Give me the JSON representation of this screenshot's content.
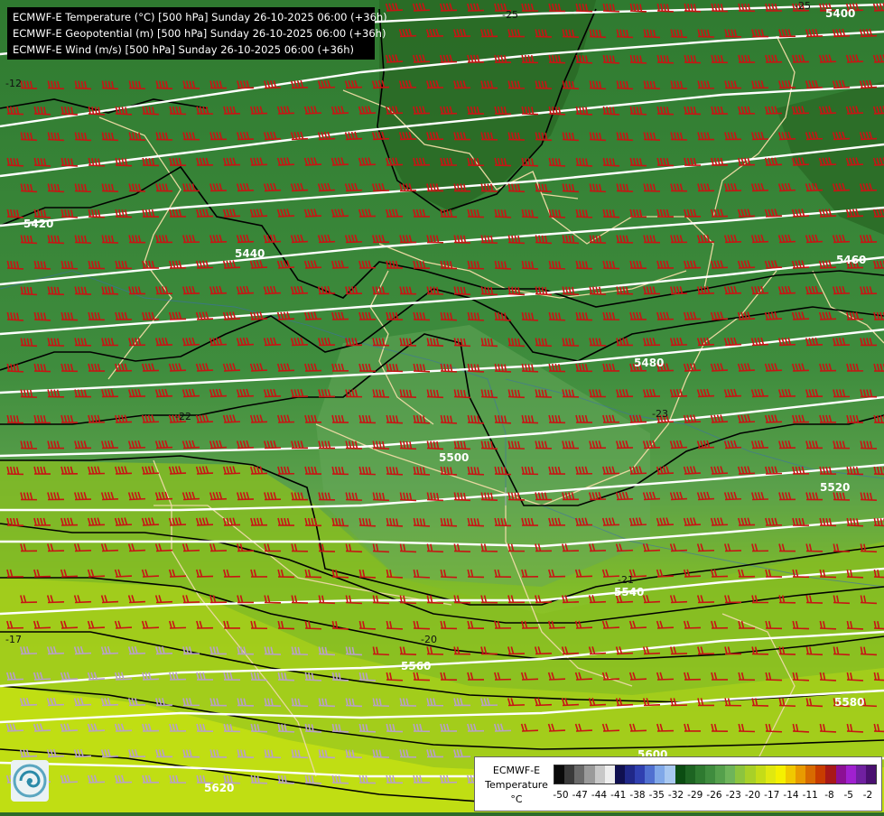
{
  "title_lines": [
    "ECMWF-E Temperature (°C) [500 hPa] Sunday 26-10-2025 06:00 (+36h)",
    "ECMWF-E Geopotential (m) [500 hPa] Sunday 26-10-2025 06:00 (+36h)",
    "ECMWF-E Wind (m/s) [500 hPa] Sunday 26-10-2025 06:00 (+36h)"
  ],
  "geopotential_labels": [
    "5400",
    "5420",
    "5440",
    "5460",
    "5480",
    "5500",
    "5520",
    "5540",
    "5560",
    "5580",
    "5600",
    "5620"
  ],
  "temperature_labels": [
    "-25",
    "-25",
    "-22",
    "-23",
    "-21",
    "-20",
    "-17",
    "-12"
  ],
  "legend": {
    "title_lines": [
      "ECMWF-E",
      "Temperature",
      "°C"
    ],
    "ticks": [
      "-50",
      "-47",
      "-44",
      "-41",
      "-38",
      "-35",
      "-32",
      "-29",
      "-26",
      "-23",
      "-20",
      "-17",
      "-14",
      "-11",
      "-8",
      "-5",
      "-2"
    ],
    "colors": [
      "#0a0a0a",
      "#3a3a3a",
      "#6a6a6a",
      "#9a9a9a",
      "#c8c8c8",
      "#eeeeee",
      "#101050",
      "#202888",
      "#3040b0",
      "#5070d0",
      "#80a8e8",
      "#a8c8f0",
      "#0b4d12",
      "#1d6422",
      "#2e7a30",
      "#3f8c3e",
      "#55a04c",
      "#6eb45a",
      "#8cc43e",
      "#a8d028",
      "#c4dc18",
      "#e0e810",
      "#f5f000",
      "#f0c800",
      "#e89a00",
      "#d86a00",
      "#c83c00",
      "#a81818",
      "#8c1094",
      "#a020d0",
      "#7020a0",
      "#4a1070"
    ]
  },
  "colors": {
    "barb": "#c81414",
    "barb_south": "#b8a0c8",
    "isohypse": "#ffffff",
    "isotherm": "#000000",
    "border": "#e8d8a0"
  }
}
